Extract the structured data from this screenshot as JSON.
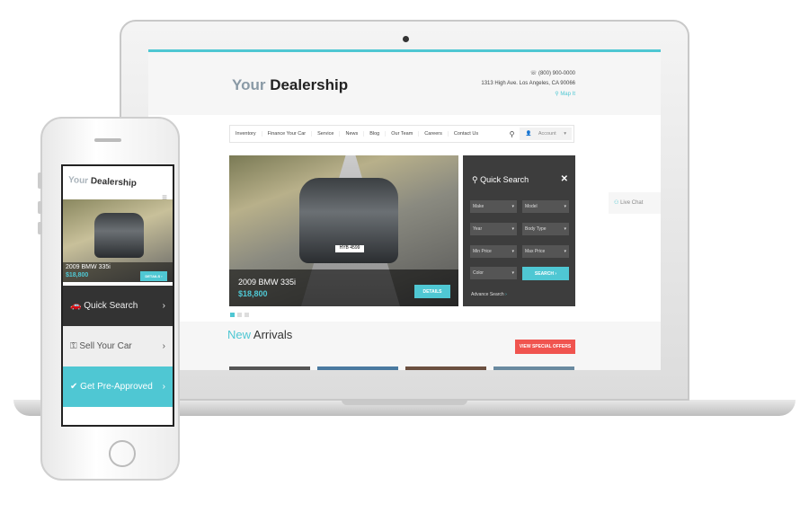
{
  "site": {
    "logo_first": "Your",
    "logo_second": "Dealership",
    "phone": "(800) 900-0000",
    "address": "1313 High Ave. Los Angeles, CA 90066",
    "map_link": "Map It"
  },
  "nav": {
    "items": [
      "Inventory",
      "Finance Your Car",
      "Service",
      "News",
      "Blog",
      "Our Team",
      "Careers",
      "Contact Us"
    ],
    "account": "Account"
  },
  "slide": {
    "title": "2009 BMW 335i",
    "price": "$18,800",
    "details": "DETAILS",
    "plate": "HYB 4599"
  },
  "quick_search": {
    "title": "Quick Search",
    "fields": [
      "Make",
      "Model",
      "Year",
      "Body Type",
      "Min Price",
      "Max Price",
      "Color"
    ],
    "search": "SEARCH",
    "advanced": "Advance Search"
  },
  "live_chat": "Live Chat",
  "arrivals": {
    "new": "New",
    "rest": "Arrivals",
    "offers": "VIEW SPECIAL OFFERS"
  },
  "mobile": {
    "logo_first": "Your",
    "logo_second": "Dealership",
    "title": "2009 BMW 335i",
    "price": "$18,800",
    "details": "DETAILS",
    "menu": [
      "Quick Search",
      "Sell Your Car",
      "Get Pre-Approved"
    ]
  },
  "colors": {
    "accent": "#4fc7d3",
    "offers": "#f0544f",
    "dark": "#3d3d3d"
  }
}
